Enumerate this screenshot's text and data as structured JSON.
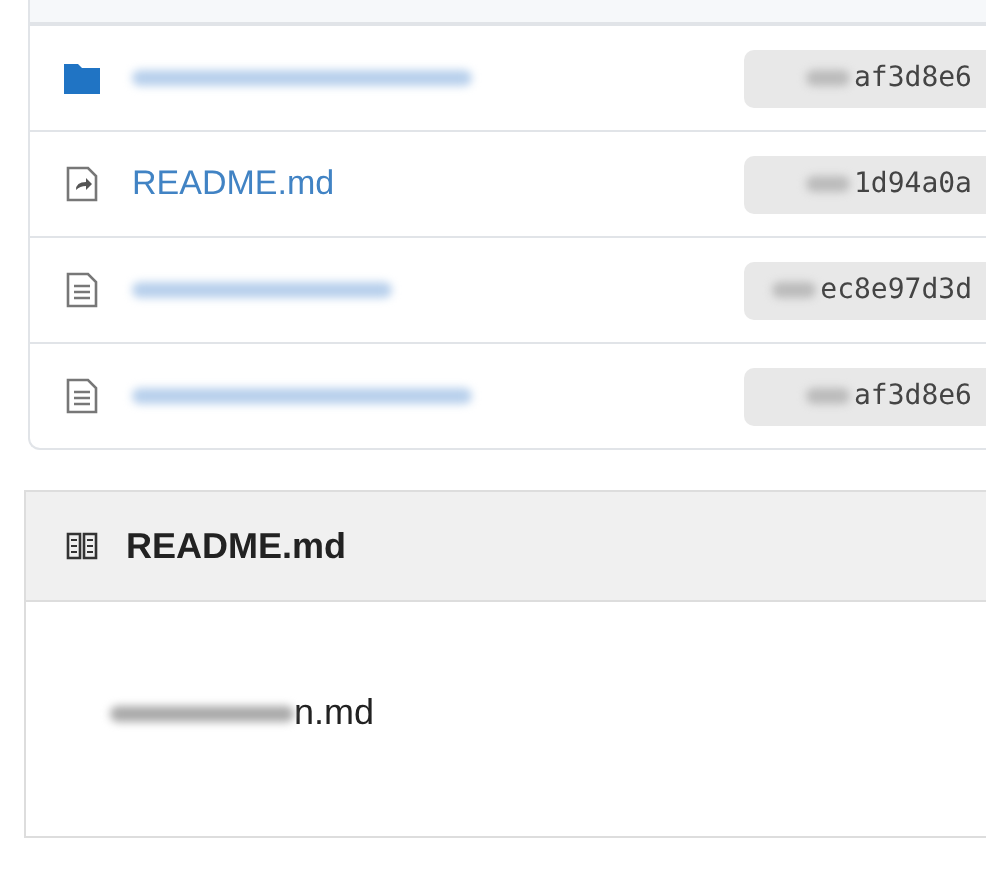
{
  "files": [
    {
      "kind": "folder",
      "name_redacted": true,
      "commit": "af3d8e6",
      "commit_redacted": true
    },
    {
      "kind": "symlink",
      "name": "README.md",
      "name_redacted": false,
      "commit": "1d94a0a",
      "commit_redacted": true
    },
    {
      "kind": "file",
      "name_redacted": true,
      "commit": "ec8e97d3d",
      "commit_redacted": true
    },
    {
      "kind": "file",
      "name_redacted": true,
      "commit": "af3d8e6",
      "commit_redacted": true
    }
  ],
  "readme": {
    "title": "README.md",
    "body": "n.md",
    "body_redacted": true
  }
}
